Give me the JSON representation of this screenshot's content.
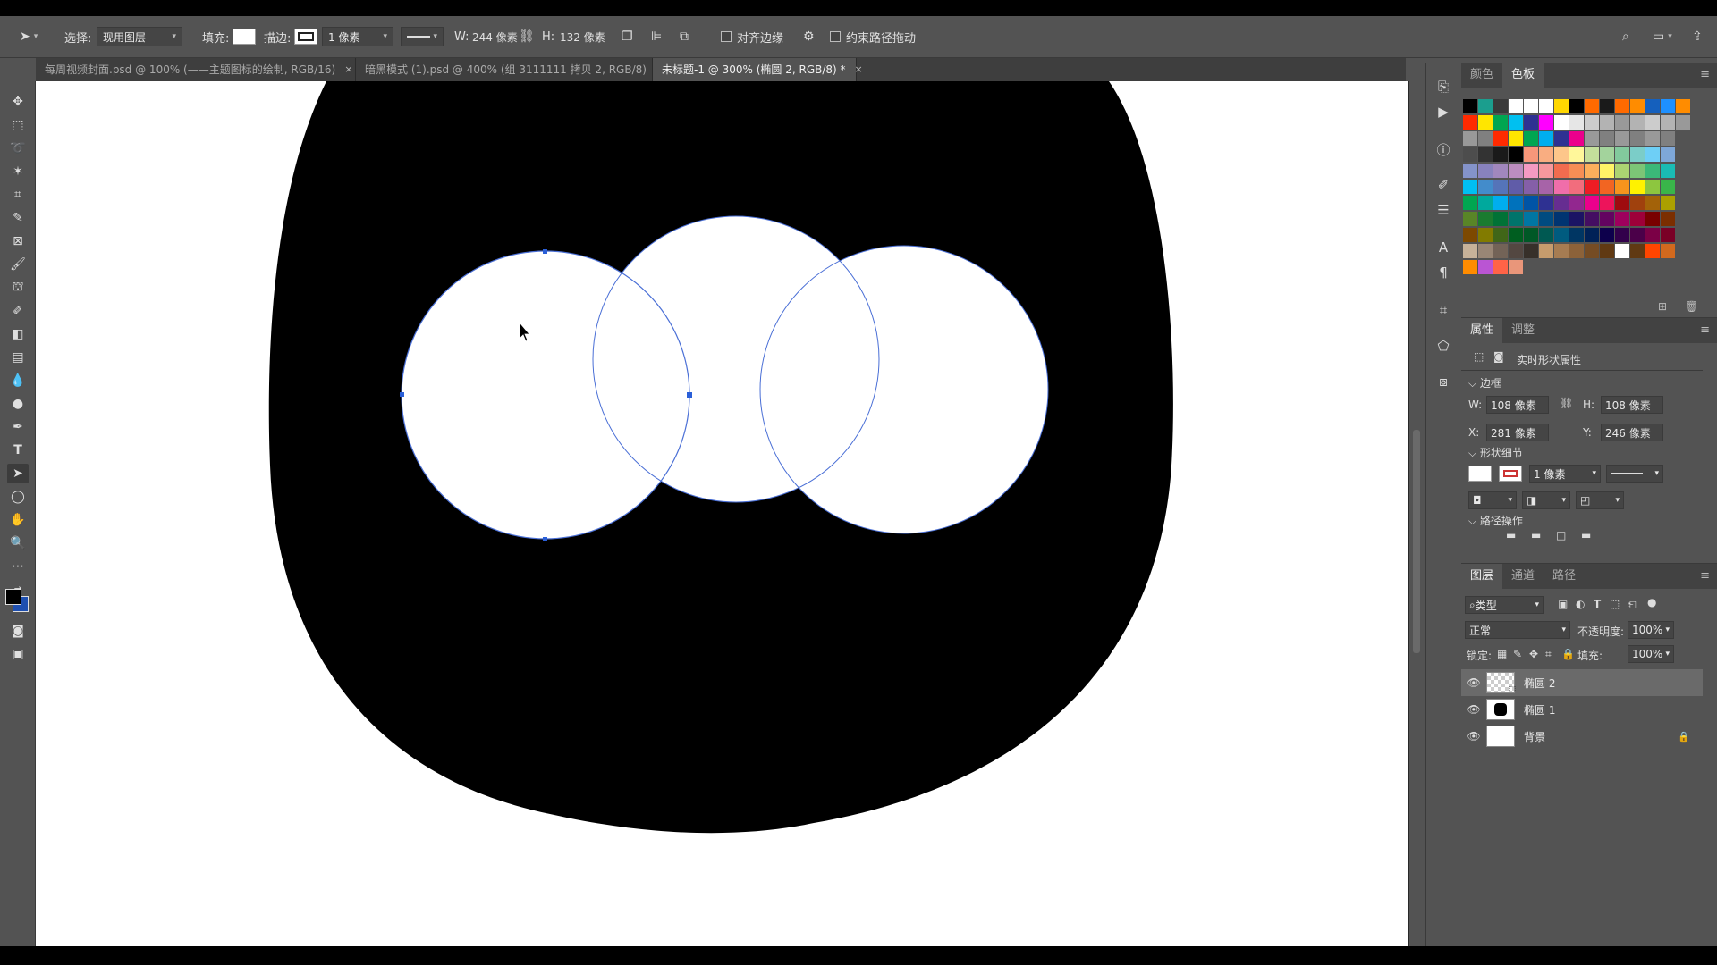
{
  "options_bar": {
    "select_label": "选择:",
    "select_value": "现用图层",
    "fill_label": "填充:",
    "stroke_label": "描边:",
    "stroke_width": "1 像素",
    "w_label": "W:",
    "w_value": "244 像素",
    "h_label": "H:",
    "h_value": "132 像素",
    "align_edges_label": "对齐边缘",
    "constrain_path_label": "约束路径拖动"
  },
  "tabs": [
    {
      "label": "每周视频封面.psd @ 100% (——主题图标的绘制, RGB/16)",
      "close": "×"
    },
    {
      "label": "暗黑模式 (1).psd @ 400% (组 3111111 拷贝 2, RGB/8)",
      "close": "×"
    },
    {
      "label": "未标题-1 @ 300% (椭圆 2, RGB/8) *",
      "close": "×"
    }
  ],
  "swatch_panel": {
    "tabs": [
      "颜色",
      "色板"
    ],
    "active_tab": "色板",
    "rows": [
      [
        "#000000",
        "#1b9e8e",
        "#3a3a3a",
        "#ffffff",
        "#ffffff",
        "#ffffff",
        "#ffd700",
        "#000000",
        "#ff6a00",
        "#1a1a1a",
        "#ff6a00",
        "#ff8c00",
        "#1560bd",
        "#1e90ff",
        "#ff8c00"
      ],
      [
        "#ff2a00",
        "#ffe600",
        "#00a651",
        "#00c0f0",
        "#2e3192",
        "#ff00ff",
        "#ffffff",
        "#e6e6e6",
        "#cccccc",
        "#b3b3b3",
        "#999999",
        "#b3b3b3",
        "#cccccc",
        "#b3b3b3",
        "#999999"
      ],
      [
        "#999999",
        "#808080",
        "#ff2a00",
        "#ffe600",
        "#00a651",
        "#00aeef",
        "#2e3192",
        "#ec008c",
        "#999999",
        "#808080",
        "#999999",
        "#808080",
        "#999999",
        "#808080"
      ],
      [
        "#4d4d4d",
        "#333333",
        "#1a1a1a",
        "#000000",
        "#f7977a",
        "#f9ad81",
        "#fdc68a",
        "#fff79a",
        "#c4df9b",
        "#a3d39c",
        "#82ca9d",
        "#7bcdc8",
        "#6ecff6",
        "#7ea7d8"
      ],
      [
        "#8493ca",
        "#8882be",
        "#a187be",
        "#bc8dbf",
        "#f49ac2",
        "#f6989d",
        "#f26c4f",
        "#f68e55",
        "#fbaf5c",
        "#fff467",
        "#acd372",
        "#7cc576",
        "#3bb878",
        "#1abbb4"
      ],
      [
        "#00bff3",
        "#438ccb",
        "#5574b9",
        "#605ca8",
        "#855fa8",
        "#a763a8",
        "#f06eaa",
        "#f26d7d",
        "#ed1c24",
        "#f26522",
        "#f7941d",
        "#fff200",
        "#8dc63f",
        "#39b54a"
      ],
      [
        "#00a651",
        "#00a99d",
        "#00aeef",
        "#0072bc",
        "#0054a6",
        "#2e3192",
        "#662d91",
        "#92278f",
        "#ec008c",
        "#ed145b",
        "#9e0b0f",
        "#a0410d",
        "#a36209",
        "#aba000"
      ],
      [
        "#598527",
        "#1a7b30",
        "#007236",
        "#00746b",
        "#0076a3",
        "#004b80",
        "#003471",
        "#1b1464",
        "#440e62",
        "#630460",
        "#9e005d",
        "#9e0039",
        "#790000",
        "#7b2e00"
      ],
      [
        "#7d4900",
        "#827b00",
        "#406618",
        "#005e20",
        "#005826",
        "#005952",
        "#005b7f",
        "#003663",
        "#002157",
        "#0d004c",
        "#32004b",
        "#4b0049",
        "#7b0046",
        "#7a0026"
      ],
      [
        "#c7b299",
        "#998675",
        "#736357",
        "#534741",
        "#37302a",
        "#c69c6d",
        "#a67c52",
        "#8c6239",
        "#754c24",
        "#603913",
        "#ffffff",
        "#603913",
        "#ff4500",
        "#d2691e"
      ],
      [
        "#ff8c00",
        "#ba55d3",
        "#ff6347",
        "#e9967a"
      ]
    ]
  },
  "properties_panel": {
    "tabs": [
      "属性",
      "调整"
    ],
    "title": "实时形状属性",
    "section_bounds": "边框",
    "w_label": "W:",
    "w_value": "108 像素",
    "h_label": "H:",
    "h_value": "108 像素",
    "x_label": "X:",
    "x_value": "281 像素",
    "y_label": "Y:",
    "y_value": "246 像素",
    "section_shape": "形状细节",
    "stroke_width": "1 像素",
    "section_path": "路径操作"
  },
  "layers_panel": {
    "tabs": [
      "图层",
      "通道",
      "路径"
    ],
    "filter_value": "类型",
    "blend_mode": "正常",
    "opacity_label": "不透明度:",
    "opacity_value": "100%",
    "lock_label": "锁定:",
    "fill_label": "填充:",
    "fill_value": "100%",
    "layers": [
      {
        "name": "椭圆 2",
        "selected": true
      },
      {
        "name": "椭圆 1",
        "selected": false
      },
      {
        "name": "背景",
        "selected": false,
        "locked": true
      }
    ]
  },
  "colors": {
    "panel_bg": "#535353",
    "path_blue": "#4a6fd6"
  }
}
